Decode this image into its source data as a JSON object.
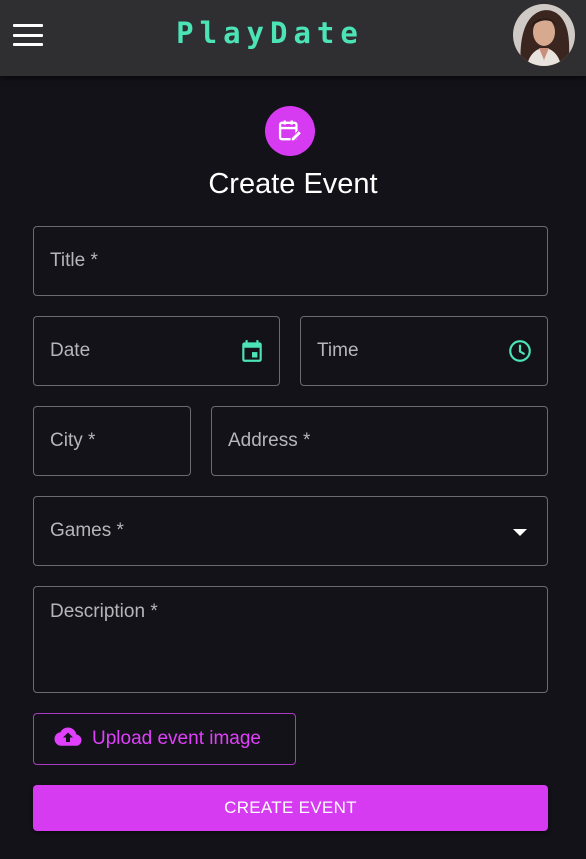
{
  "appbar": {
    "brand": "PlayDate",
    "brand_color": "#4ce3b5",
    "menu_icon": "menu-icon",
    "avatar": "user-avatar"
  },
  "form": {
    "header_icon": "calendar-edit-icon",
    "title": "Create Event",
    "fields": {
      "title": {
        "label": "Title *",
        "value": ""
      },
      "date": {
        "label": "Date",
        "value": "",
        "icon": "calendar-icon"
      },
      "time": {
        "label": "Time",
        "value": "",
        "icon": "clock-icon"
      },
      "city": {
        "label": "City *",
        "value": ""
      },
      "address": {
        "label": "Address *",
        "value": ""
      },
      "games": {
        "label": "Games *",
        "value": "",
        "icon": "dropdown-arrow-icon"
      },
      "description": {
        "label": "Description *",
        "value": ""
      }
    },
    "upload_button": {
      "label": "Upload event image",
      "icon": "cloud-upload-icon"
    },
    "submit_button": {
      "label": "CREATE EVENT"
    }
  },
  "colors": {
    "background": "#131218",
    "appbar": "#2f2f31",
    "accent": "#d63bf1",
    "icon_accent": "#4ce3b5",
    "border": "#6a6a70"
  }
}
